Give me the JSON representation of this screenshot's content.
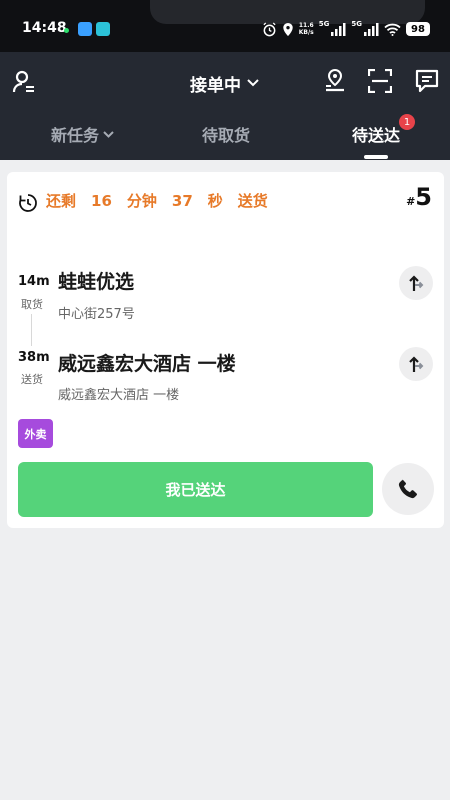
{
  "status_bar": {
    "time": "14:48",
    "net_speed_value": "11.6",
    "net_speed_unit": "KB/s",
    "sim1": "5G",
    "sim2": "5G",
    "battery": "98"
  },
  "header": {
    "title": "接单中",
    "icons": [
      "user-settings-icon",
      "location-route-icon",
      "scan-icon",
      "message-icon"
    ],
    "tabs": [
      {
        "label": "新任务",
        "has_dropdown": true
      },
      {
        "label": "待取货"
      },
      {
        "label": "待送达",
        "active": true,
        "badge": "1"
      }
    ]
  },
  "order": {
    "timer": {
      "prefix": "还剩",
      "minutes": "16",
      "minutes_unit": "分钟",
      "seconds": "37",
      "seconds_unit": "秒",
      "suffix": "送货"
    },
    "number_prefix": "#",
    "number": "5",
    "pickup": {
      "time": "14m",
      "kind": "取货",
      "name": "蛙蛙优选",
      "address": "中心街257号"
    },
    "delivery": {
      "time": "38m",
      "kind": "送货",
      "name": "威远鑫宏大酒店 一楼",
      "address": "威远鑫宏大酒店 一楼"
    },
    "tag": "外卖",
    "arrive_button": "我已送达"
  },
  "colors": {
    "header_bg": "#252932",
    "accent_orange": "#e77a29",
    "arrive_green": "#55d37a",
    "tag_purple": "#a64bdd",
    "badge_red": "#e8434a"
  }
}
